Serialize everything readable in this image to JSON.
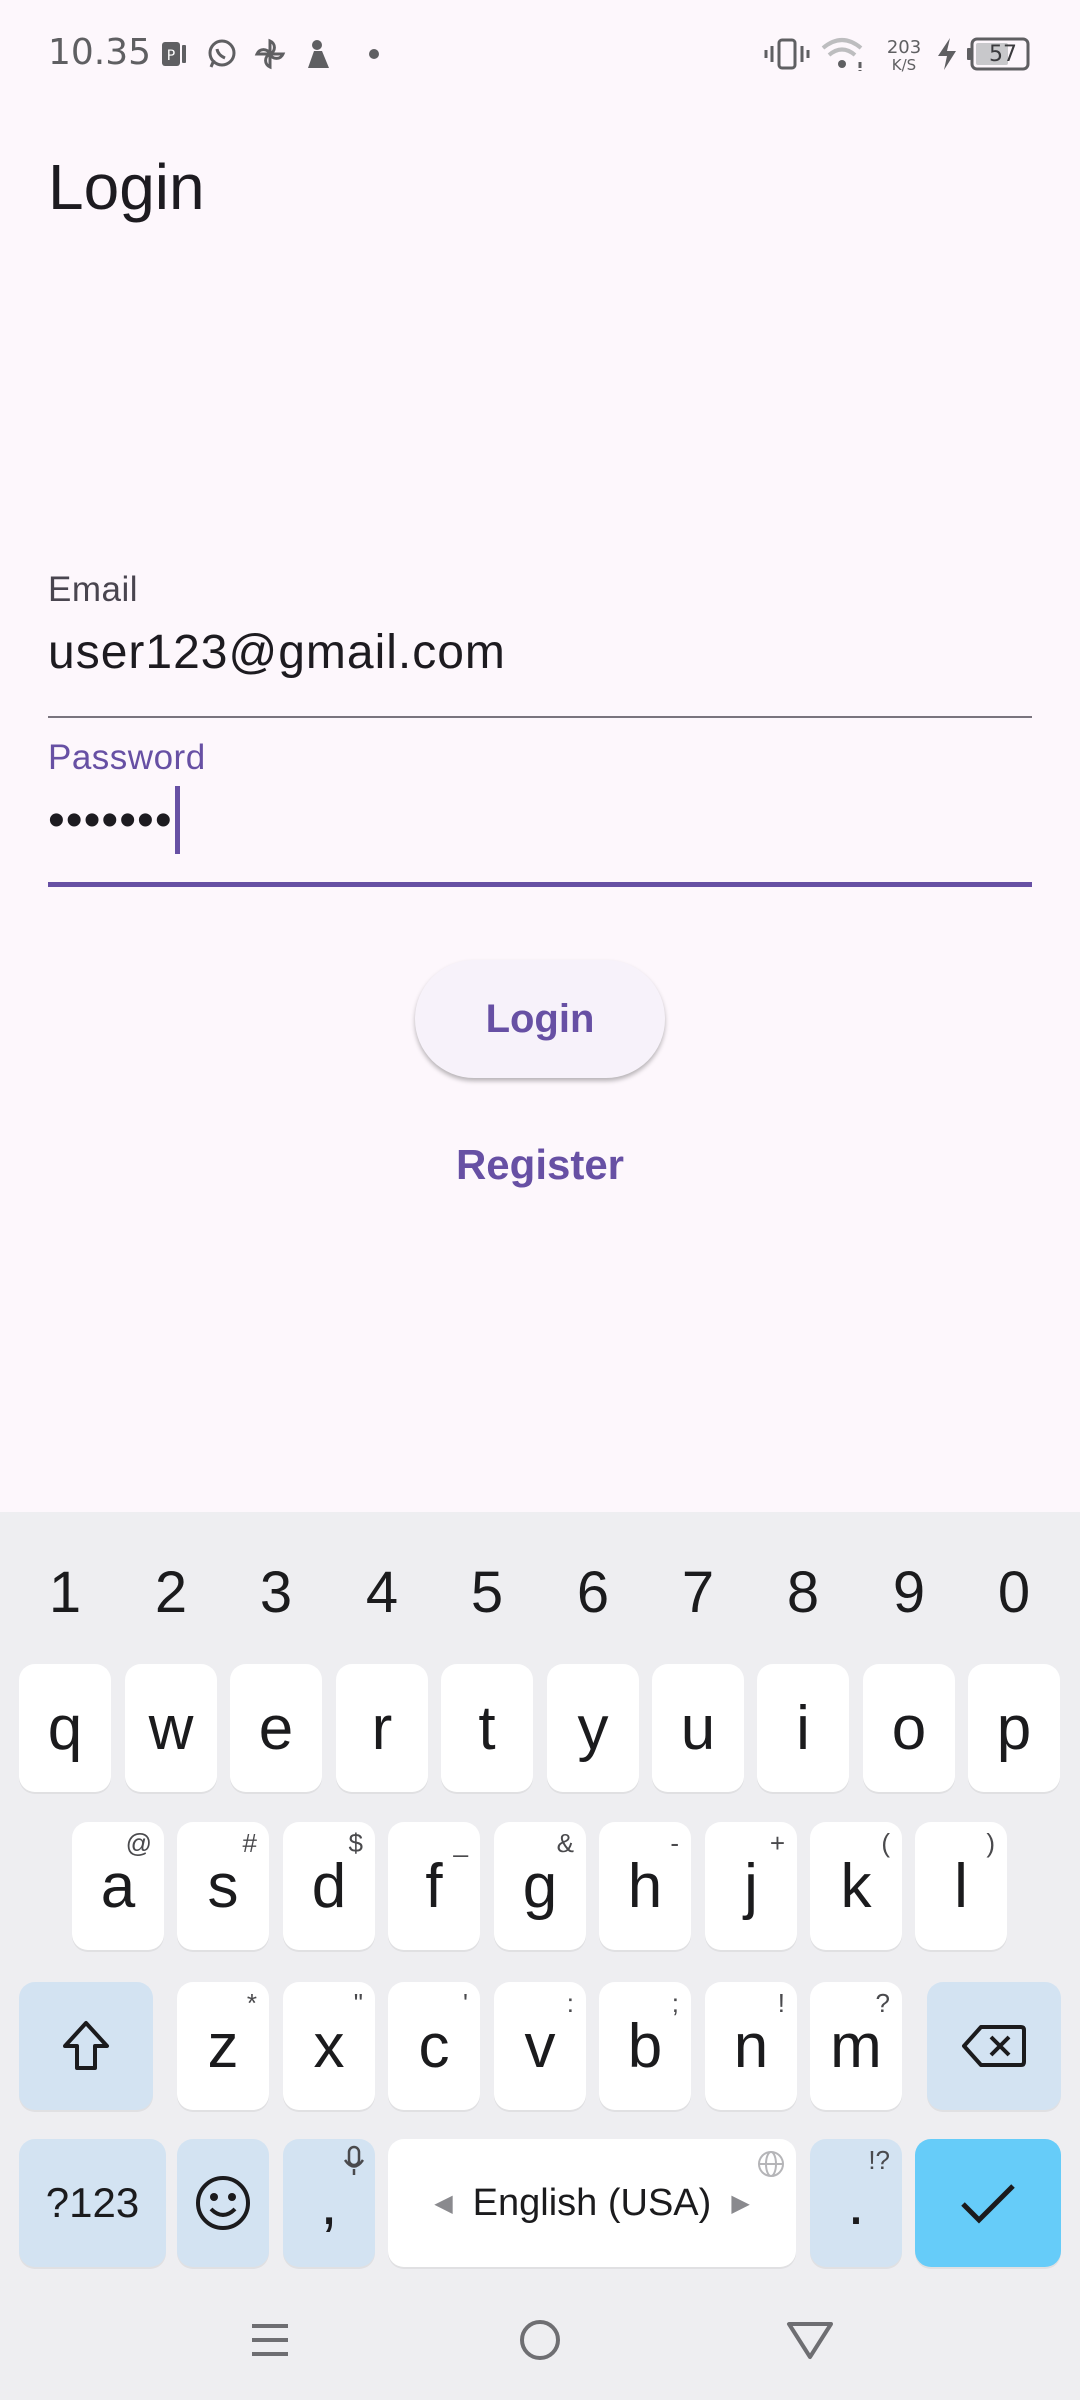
{
  "status_bar": {
    "time": "10.35",
    "network_speed_value": "203",
    "network_speed_unit": "K/S",
    "battery_level": "57",
    "icons": [
      "notification-app-icon",
      "whatsapp-icon",
      "pinwheel-icon",
      "app-icon",
      "dot-icon",
      "vibrate-icon",
      "wifi-icon",
      "charging-icon",
      "battery-icon"
    ]
  },
  "page": {
    "title": "Login"
  },
  "form": {
    "email_label": "Email",
    "email_value": "user123@gmail.com",
    "password_label": "Password",
    "password_value": "•••••••",
    "login_button": "Login",
    "register_link": "Register"
  },
  "colors": {
    "background": "#fdf7fc",
    "primary": "#6750a4",
    "keyboard_bg": "#eeeef1",
    "function_key": "#d3e3f2",
    "enter_key": "#66ccf9"
  },
  "keyboard": {
    "numbers": [
      "1",
      "2",
      "3",
      "4",
      "5",
      "6",
      "7",
      "8",
      "9",
      "0"
    ],
    "row1": [
      "q",
      "w",
      "e",
      "r",
      "t",
      "y",
      "u",
      "i",
      "o",
      "p"
    ],
    "row2": [
      {
        "key": "a",
        "hint": "@"
      },
      {
        "key": "s",
        "hint": "#"
      },
      {
        "key": "d",
        "hint": "$"
      },
      {
        "key": "f",
        "hint": "_"
      },
      {
        "key": "g",
        "hint": "&"
      },
      {
        "key": "h",
        "hint": "-"
      },
      {
        "key": "j",
        "hint": "+"
      },
      {
        "key": "k",
        "hint": "("
      },
      {
        "key": "l",
        "hint": ")"
      }
    ],
    "row3": [
      {
        "key": "z",
        "hint": "*"
      },
      {
        "key": "x",
        "hint": "\""
      },
      {
        "key": "c",
        "hint": "'"
      },
      {
        "key": "v",
        "hint": ":"
      },
      {
        "key": "b",
        "hint": ";"
      },
      {
        "key": "n",
        "hint": "!"
      },
      {
        "key": "m",
        "hint": "?"
      }
    ],
    "symbols_key": "?123",
    "comma_key": ",",
    "space_label": "English (USA)",
    "period_key": ".",
    "period_hint": "!?"
  }
}
